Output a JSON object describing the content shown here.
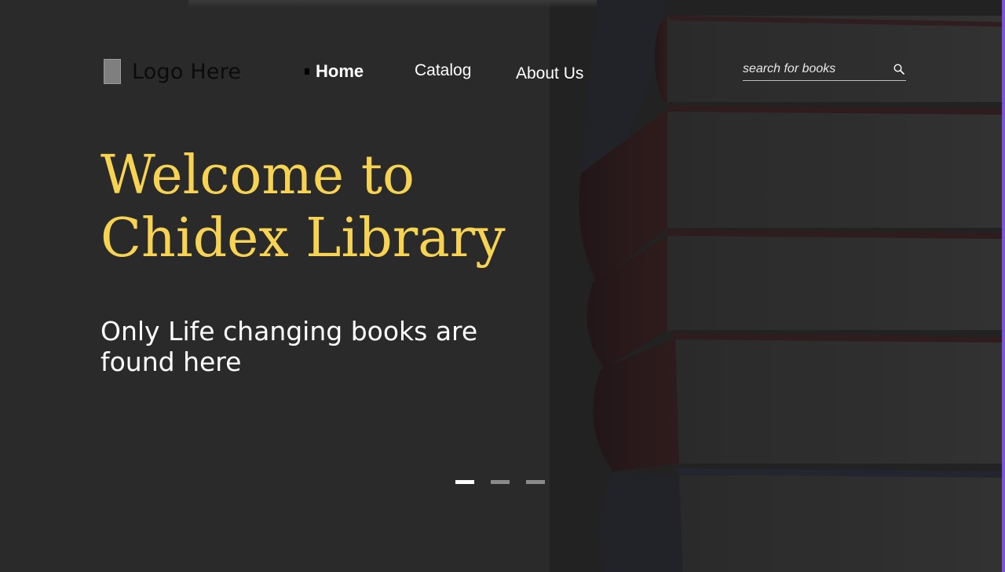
{
  "header": {
    "logo_text": "Logo Here",
    "nav": {
      "home": "Home",
      "catalog": "Catalog",
      "about": "About Us"
    },
    "search": {
      "placeholder": "search for books",
      "icon": "search-icon"
    }
  },
  "hero": {
    "title_line1": "Welcome to",
    "title_line2": "Chidex Library",
    "subtitle_line1": "Only Life changing books are",
    "subtitle_line2": "found here"
  },
  "carousel": {
    "slides": 3,
    "active_index": 0
  },
  "colors": {
    "background": "#2a2a2a",
    "title": "#f7d354",
    "text": "#ffffff",
    "accent_edge": "#8b5cf6"
  }
}
